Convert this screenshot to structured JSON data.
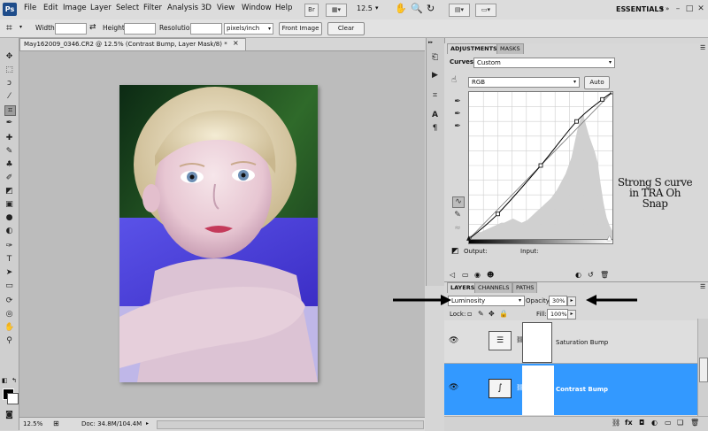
{
  "app": {
    "logo": "Ps"
  },
  "menubar": {
    "items": [
      "File",
      "Edit",
      "Image",
      "Layer",
      "Select",
      "Filter",
      "Analysis",
      "3D",
      "View",
      "Window",
      "Help"
    ],
    "zoom": "12.5",
    "workspace": "ESSENTIALS",
    "workspace_arrow": "▾",
    "tb_br": "Br",
    "window_controls": {
      "minimize": "–",
      "maximize": "□",
      "close": "✕"
    }
  },
  "options": {
    "width_label": "Width:",
    "height_label": "Height:",
    "resolution_label": "Resolution:",
    "resolution_unit": "pixels/inch",
    "front_image_label": "Front Image",
    "clear_label": "Clear"
  },
  "document": {
    "tab_title": "May162009_0346.CR2 @ 12.5% (Contrast Bump, Layer Mask/8) *",
    "close": "×",
    "status_zoom": "12.5%",
    "status_doc": "Doc: 34.8M/104.4M"
  },
  "adjustments": {
    "tabs": [
      "ADJUSTMENTS",
      "MASKS"
    ],
    "curves_label": "Curves",
    "preset_value": "Custom",
    "channel_value": "RGB",
    "auto_label": "Auto",
    "output_label": "Output:",
    "input_label": "Input:",
    "curve_points": [
      [
        0,
        0
      ],
      [
        0.2,
        0.17
      ],
      [
        0.5,
        0.5
      ],
      [
        0.75,
        0.8
      ],
      [
        0.93,
        0.95
      ],
      [
        1,
        1
      ]
    ],
    "histogram": [
      2,
      3,
      4,
      5,
      5,
      6,
      7,
      8,
      9,
      10,
      11,
      12,
      12,
      13,
      14,
      15,
      14,
      13,
      12,
      13,
      14,
      16,
      18,
      20,
      22,
      24,
      26,
      28,
      30,
      33,
      36,
      40,
      44,
      48,
      54,
      60,
      70,
      80,
      88,
      92,
      84,
      76,
      70,
      64,
      56,
      40,
      26,
      16,
      10,
      6
    ]
  },
  "layers": {
    "tabs": [
      "LAYERS",
      "CHANNELS",
      "PATHS"
    ],
    "blend_mode": "Luminosity",
    "opacity_label": "Opacity:",
    "opacity_value": "30%",
    "lock_label": "Lock:",
    "fill_label": "Fill:",
    "fill_value": "100%",
    "rows": [
      {
        "name": "Saturation Bump",
        "selected": false
      },
      {
        "name": "Contrast Bump",
        "selected": true
      }
    ]
  },
  "annotation": {
    "line1": "Strong S curve",
    "line2": "in TRA Oh",
    "line3": "Snap"
  },
  "colors": {
    "selection": "#3399ff",
    "menubar": "#dcdcdc",
    "canvas_bg": "#bcbcbc",
    "photo_pool": "#4b3fd8"
  }
}
